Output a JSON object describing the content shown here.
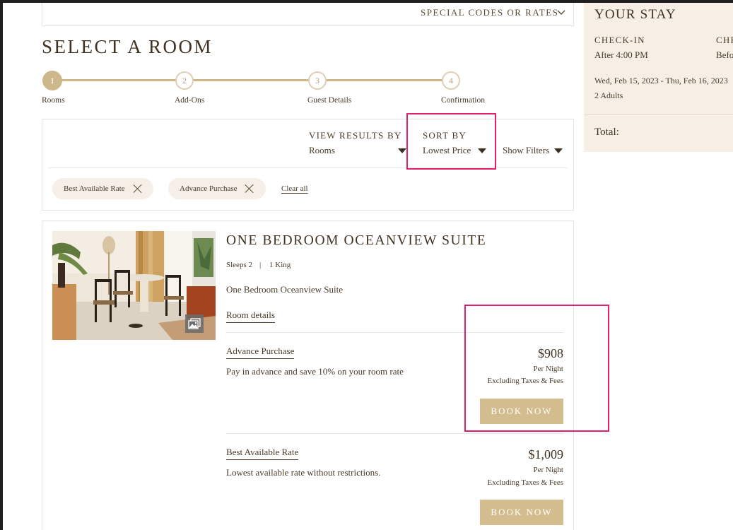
{
  "header": {
    "special_codes_label": "SPECIAL CODES OR RATES"
  },
  "page_title": "SELECT A ROOM",
  "steps": [
    {
      "num": "1",
      "label": "Rooms",
      "active": true
    },
    {
      "num": "2",
      "label": "Add-Ons",
      "active": false
    },
    {
      "num": "3",
      "label": "Guest Details",
      "active": false
    },
    {
      "num": "4",
      "label": "Confirmation",
      "active": false
    }
  ],
  "controls": {
    "view_results_label": "VIEW RESULTS BY",
    "view_results_value": "Rooms",
    "sort_by_label": "SORT BY",
    "sort_by_value": "Lowest Price",
    "show_filters": "Show Filters"
  },
  "filters": {
    "chips": [
      "Best Available Rate",
      "Advance Purchase"
    ],
    "clear_all": "Clear all"
  },
  "room": {
    "name": "ONE BEDROOM OCEANVIEW SUITE",
    "sleeps": "Sleeps 2",
    "separator": "|",
    "bed": "1 King",
    "description": "One Bedroom Oceanview Suite",
    "details_link": "Room details",
    "rates": [
      {
        "name": "Advance Purchase",
        "description": "Pay in advance and save 10% on your room rate",
        "price": "$908",
        "per": "Per Night",
        "note": "Excluding Taxes & Fees",
        "button": "BOOK NOW"
      },
      {
        "name": "Best Available Rate",
        "description": "Lowest available rate without restrictions.",
        "price": "$1,009",
        "per": "Per Night",
        "note": "Excluding Taxes & Fees",
        "button": "BOOK NOW"
      }
    ]
  },
  "stay": {
    "title": "YOUR STAY",
    "checkin_label": "CHECK-IN",
    "checkin_value": "After 4:00 PM",
    "checkout_label": "CHE",
    "checkout_value": "Befo",
    "dates": "Wed, Feb 15, 2023 - Thu, Feb 16, 2023",
    "guests": "2 Adults",
    "total_label": "Total:"
  },
  "colors": {
    "accent_gold": "#cdb88c",
    "button": "#d3bd8f",
    "highlight": "#e0206b",
    "panel_bg": "#f7efe6"
  }
}
